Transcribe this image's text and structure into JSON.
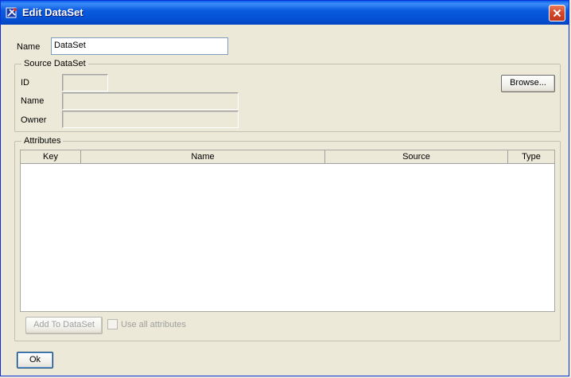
{
  "window": {
    "title": "Edit DataSet"
  },
  "name_field": {
    "label": "Name",
    "value": "DataSet"
  },
  "source_dataset": {
    "legend": "Source DataSet",
    "id_label": "ID",
    "id_value": "",
    "name_label": "Name",
    "name_value": "",
    "owner_label": "Owner",
    "owner_value": "",
    "browse_label": "Browse..."
  },
  "attributes": {
    "legend": "Attributes",
    "columns": [
      "Key",
      "Name",
      "Source",
      "Type"
    ],
    "rows": [],
    "add_button_label": "Add To DataSet",
    "use_all_label": "Use all attributes",
    "use_all_checked": false
  },
  "ok_label": "Ok",
  "colors": {
    "titlebar": "#0553d6",
    "window_bg": "#ece9d8",
    "close": "#d4462a"
  }
}
